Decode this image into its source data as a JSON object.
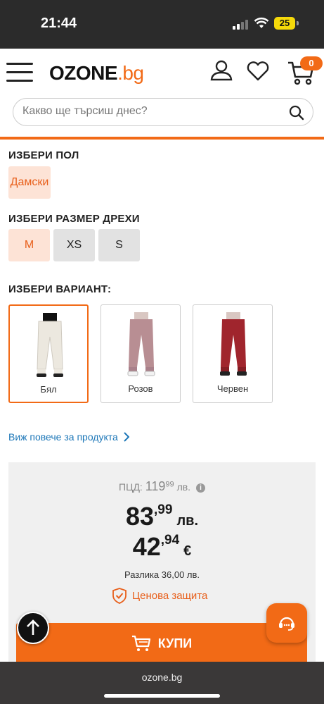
{
  "status": {
    "time": "21:44",
    "battery": "25"
  },
  "header": {
    "logo_main": "OZONE",
    "logo_tld": ".bg",
    "cart_count": "0"
  },
  "search": {
    "placeholder": "Какво ще търсиш днес?"
  },
  "gender": {
    "title": "ИЗБЕРИ ПОЛ",
    "options": [
      "Дамски"
    ],
    "selected": "Дамски"
  },
  "size": {
    "title": "ИЗБЕРИ РАЗМЕР ДРЕХИ",
    "options": [
      "M",
      "XS",
      "S"
    ],
    "selected": "M"
  },
  "variant": {
    "title": "ИЗБЕРИ ВАРИАНТ:",
    "options": [
      "Бял",
      "Розов",
      "Червен"
    ],
    "selected": "Бял",
    "colors": [
      "#ece8df",
      "#b88e93",
      "#a0252d"
    ]
  },
  "more_link": "Виж повече за продукта",
  "price": {
    "rrp_label": "ПЦД:",
    "rrp_whole": "119",
    "rrp_cents": "99",
    "rrp_currency": "лв.",
    "bgn_whole": "83",
    "bgn_cents": ",99",
    "bgn_currency": "лв.",
    "eur_whole": "42",
    "eur_cents": ",94",
    "eur_currency": "€",
    "difference": "Разлика 36,00 лв.",
    "protection": "Ценова защита"
  },
  "buy_button": "КУПИ",
  "browser": {
    "url": "ozone.bg"
  },
  "colors": {
    "accent": "#f26a16",
    "link": "#1d77b8"
  }
}
